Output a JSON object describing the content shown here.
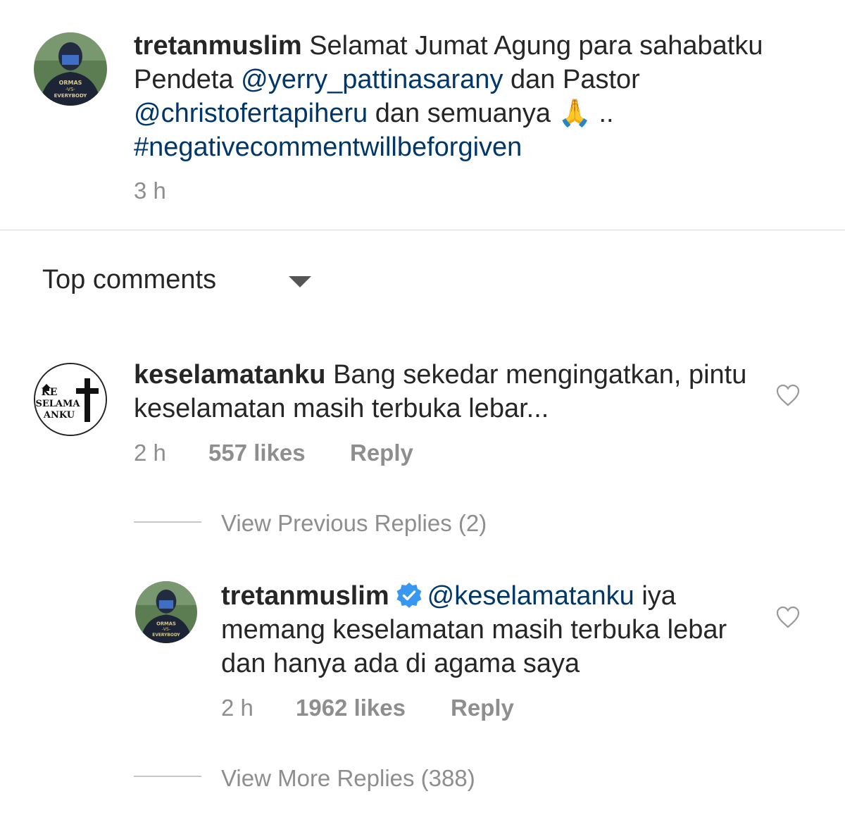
{
  "caption": {
    "username": "tretanmuslim",
    "text_1": "Selamat Jumat Agung para sahabatku Pendeta",
    "mention_1": "@yerry_pattinasarany",
    "text_2": "dan Pastor",
    "mention_2": "@christofertapiheru",
    "text_3": "dan semuanya 🙏 ..",
    "hashtag": "#negativecommentwillbeforgiven",
    "timestamp": "3 h",
    "avatar_text": [
      "ORMAS",
      "-VS-",
      "EVERYBODY"
    ]
  },
  "sort": {
    "label": "Top comments"
  },
  "comment": {
    "username": "keselamatanku",
    "text": "Bang sekedar mengingatkan, pintu keselamatan masih terbuka lebar...",
    "timestamp": "2 h",
    "likes": "557 likes",
    "reply_label": "Reply",
    "avatar_text": [
      "KE",
      "SELAMA",
      "ANKU"
    ]
  },
  "view_previous_replies": "View Previous Replies (2)",
  "reply": {
    "username": "tretanmuslim",
    "mention": "@keselamatanku",
    "text": "iya memang keselamatan masih terbuka lebar dan hanya ada di agama saya",
    "timestamp": "2 h",
    "likes": "1962 likes",
    "reply_label": "Reply"
  },
  "view_more_replies": "View More Replies (388)",
  "colors": {
    "text_primary": "#262626",
    "text_secondary": "#8e8e8e",
    "link": "#00376b",
    "verified_badge": "#3897f0",
    "divider": "#dbdbdb"
  },
  "icons": [
    "chevron-down-icon",
    "heart-icon",
    "verified-badge-icon"
  ]
}
